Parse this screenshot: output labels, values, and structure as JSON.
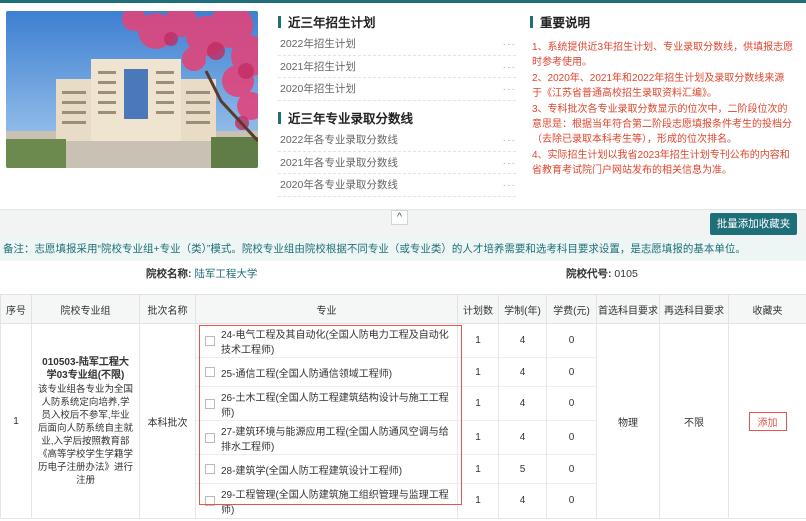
{
  "sections": {
    "plan_title": "近三年招生计划",
    "score_title": "近三年专业录取分数线",
    "notes_title": "重要说明"
  },
  "plan_links": [
    "2022年招生计划",
    "2021年招生计划",
    "2020年招生计划"
  ],
  "score_links": [
    "2022年各专业录取分数线",
    "2021年各专业录取分数线",
    "2020年各专业录取分数线"
  ],
  "link_more": "···",
  "notes": [
    "1、系统提供近3年招生计划、专业录取分数线，供填报志愿时参考使用。",
    "2、2020年、2021年和2022年招生计划及录取分数线来源于《江苏省普通高校招生录取资料汇编》。",
    "3、专科批次各专业录取分数显示的位次中，二阶段位次的意思是：根据当年符合第二阶段志愿填报条件考生的投档分（去除已录取本科考生等），形成的位次排名。",
    "4、实际招生计划以我省2023年招生计划专刊公布的内容和省教育考试院门户网站发布的相关信息为准。"
  ],
  "collapse_icon": "chevron-up-icon",
  "batch_button": "批量添加收藏夹",
  "remark_prefix": "备注：",
  "remark_text": "志愿填报采用“院校专业组+专业（类）”模式。院校专业组由院校根据不同专业（或专业类）的人才培养需要和选考科目要求设置，是志愿填报的基本单位。",
  "school_name_label": "院校名称:",
  "school_name": "陆军工程大学",
  "school_code_label": "院校代号:",
  "school_code": "0105",
  "table": {
    "headers": [
      "序号",
      "院校专业组",
      "批次名称",
      "专业",
      "计划数",
      "学制(年)",
      "学费(元)",
      "首选科目要求",
      "再选科目要求",
      "收藏夹"
    ],
    "row": {
      "index": "1",
      "group_name": "010503-陆军工程大学03专业组(不限)",
      "group_desc": "该专业组各专业为全国人防系统定向培养,学员入校后不参军,毕业后面向人防系统自主就业,入学后按照教育部《高等学校学生学籍学历电子注册办法》进行注册",
      "batch": "本科批次",
      "first_subject": "物理",
      "second_subject": "不限",
      "add_label": "添加"
    },
    "majors": [
      {
        "name": "24-电气工程及其自动化(全国人防电力工程及自动化技术工程师)",
        "plan": "1",
        "years": "4",
        "fee": "0"
      },
      {
        "name": "25-通信工程(全国人防通信领域工程师)",
        "plan": "1",
        "years": "4",
        "fee": "0"
      },
      {
        "name": "26-土木工程(全国人防工程建筑结构设计与施工工程师)",
        "plan": "1",
        "years": "4",
        "fee": "0"
      },
      {
        "name": "27-建筑环境与能源应用工程(全国人防通风空调与给排水工程师)",
        "plan": "1",
        "years": "4",
        "fee": "0"
      },
      {
        "name": "28-建筑学(全国人防工程建筑设计工程师)",
        "plan": "1",
        "years": "5",
        "fee": "0"
      },
      {
        "name": "29-工程管理(全国人防建筑施工组织管理与监理工程师)",
        "plan": "1",
        "years": "4",
        "fee": "0"
      }
    ]
  },
  "colors": {
    "accent": "#1f6f78",
    "notes_red": "#e0452f",
    "highlight_box": "#e6544a"
  }
}
